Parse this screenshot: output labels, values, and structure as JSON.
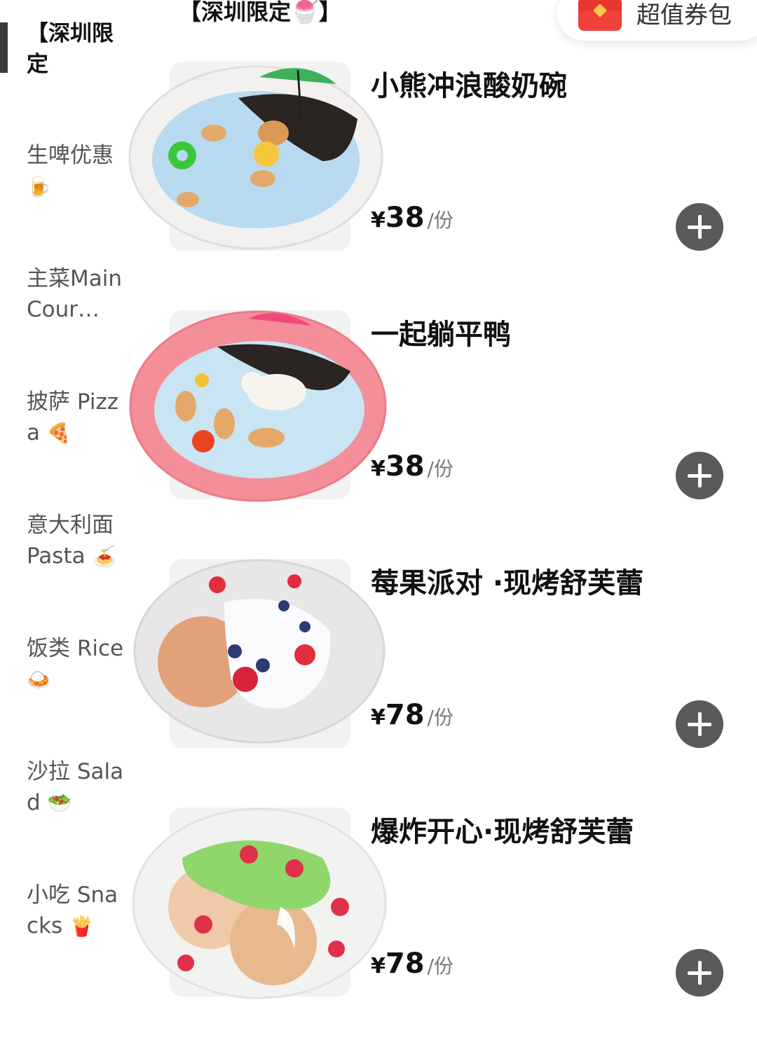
{
  "coupon": {
    "label": "超值券包",
    "icon": "red-envelope-icon"
  },
  "section_title": "【深圳限定🍧】",
  "categories": [
    {
      "label": "【深圳限定",
      "emoji_line": "定🍧】",
      "active": true
    },
    {
      "label": "生啤优惠",
      "emoji": "🍺"
    },
    {
      "label": "主菜Main Cour…",
      "emoji": ""
    },
    {
      "label": "披萨 Pizza",
      "emoji": "🍕"
    },
    {
      "label": "意大利面Pasta",
      "emoji": "🍝"
    },
    {
      "label": "饭类 Rice",
      "emoji": "🍛"
    },
    {
      "label": "沙拉 Salad",
      "emoji": "🥗"
    },
    {
      "label": "小吃 Snacks",
      "emoji": "🍟"
    }
  ],
  "items": [
    {
      "name": "小熊冲浪酸奶碗",
      "currency": "¥",
      "price": "38",
      "unit": "/份",
      "plate_color": "#f3f1ef"
    },
    {
      "name": "一起躺平鸭",
      "currency": "¥",
      "price": "38",
      "unit": "/份",
      "plate_color": "#f48e98"
    },
    {
      "name": "莓果派对 ·现烤舒芙蕾",
      "currency": "¥",
      "price": "78",
      "unit": "/份",
      "plate_color": "#e9e6e8"
    },
    {
      "name": "爆炸开心·现烤舒芙蕾",
      "currency": "¥",
      "price": "78",
      "unit": "/份",
      "plate_color": "#f2f2f0"
    }
  ],
  "colors": {
    "add_button": "#5a5a5a",
    "coupon_red": "#f0413a",
    "active_bar": "#3a3a3a"
  }
}
